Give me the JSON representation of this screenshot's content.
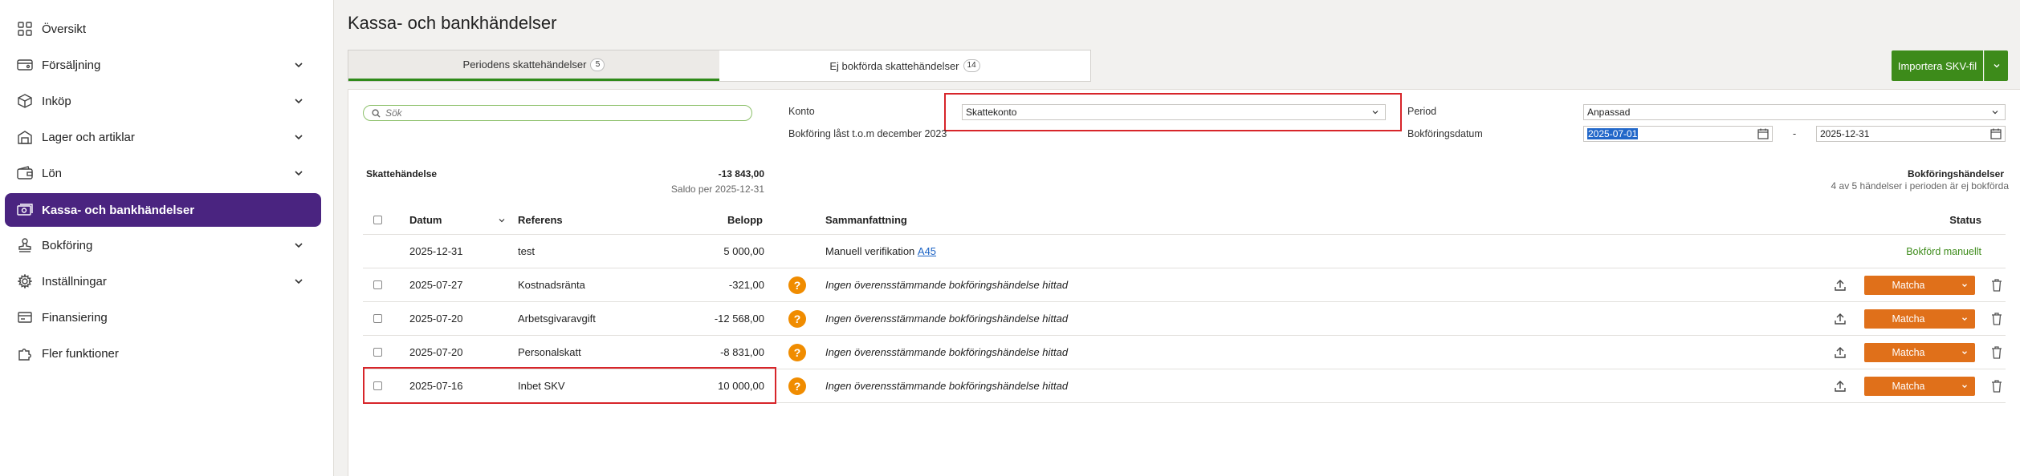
{
  "sidebar": {
    "items": [
      {
        "label": "Översikt",
        "icon": "grid-icon",
        "expandable": false
      },
      {
        "label": "Försäljning",
        "icon": "cart-icon",
        "expandable": true
      },
      {
        "label": "Inköp",
        "icon": "box-icon",
        "expandable": true
      },
      {
        "label": "Lager och artiklar",
        "icon": "warehouse-icon",
        "expandable": true
      },
      {
        "label": "Lön",
        "icon": "wallet-icon",
        "expandable": true
      },
      {
        "label": "Kassa- och bankhändelser",
        "icon": "bank-icon",
        "expandable": false,
        "active": true
      },
      {
        "label": "Bokföring",
        "icon": "stamp-icon",
        "expandable": true
      },
      {
        "label": "Inställningar",
        "icon": "gear-icon",
        "expandable": true
      },
      {
        "label": "Finansiering",
        "icon": "finance-icon",
        "expandable": false
      },
      {
        "label": "Fler funktioner",
        "icon": "puzzle-icon",
        "expandable": false
      }
    ]
  },
  "page": {
    "title": "Kassa- och bankhändelser"
  },
  "tabs": [
    {
      "label": "Periodens skattehändelser",
      "badge": "5",
      "active": true
    },
    {
      "label": "Ej bokförda skattehändelser",
      "badge": "14",
      "active": false
    }
  ],
  "import_button": {
    "label": "Importera SKV-fil"
  },
  "filters": {
    "search_placeholder": "Sök",
    "konto_label": "Konto",
    "konto_value": "Skattekonto",
    "lock_text": "Bokföring låst t.o.m december 2023",
    "period_label": "Period",
    "period_value": "Anpassad",
    "date_label": "Bokföringsdatum",
    "date_from": "2025-07-01",
    "date_sep": "-",
    "date_to": "2025-12-31"
  },
  "summary": {
    "left_label": "Skattehändelse",
    "amount": "-13 843,00",
    "saldo": "Saldo per 2025-12-31",
    "right_label": "Bokföringshändelser",
    "right_sub": "4 av 5 händelser i perioden är ej bokförda"
  },
  "table": {
    "headers": {
      "datum": "Datum",
      "referens": "Referens",
      "belopp": "Belopp",
      "sammanfattning": "Sammanfattning",
      "status": "Status"
    },
    "rows": [
      {
        "datum": "2025-12-31",
        "referens": "test",
        "belopp": "5 000,00",
        "sammanfattning": "Manuell verifikation",
        "link": "A45",
        "status": "Bokförd manuellt",
        "booked": true
      },
      {
        "datum": "2025-07-27",
        "referens": "Kostnadsränta",
        "belopp": "-321,00",
        "sammanfattning": "Ingen överensstämmande bokföringshändelse hittad",
        "match": "Matcha",
        "booked": false
      },
      {
        "datum": "2025-07-20",
        "referens": "Arbetsgivaravgift",
        "belopp": "-12 568,00",
        "sammanfattning": "Ingen överensstämmande bokföringshändelse hittad",
        "match": "Matcha",
        "booked": false
      },
      {
        "datum": "2025-07-20",
        "referens": "Personalskatt",
        "belopp": "-8 831,00",
        "sammanfattning": "Ingen överensstämmande bokföringshändelse hittad",
        "match": "Matcha",
        "booked": false
      },
      {
        "datum": "2025-07-16",
        "referens": "Inbet SKV",
        "belopp": "10 000,00",
        "sammanfattning": "Ingen överensstämmande bokföringshändelse hittad",
        "match": "Matcha",
        "booked": false
      }
    ]
  },
  "colors": {
    "brand_purple": "#4a2480",
    "green": "#3d8b1a",
    "orange": "#e0701a",
    "highlight_red": "#d7252a"
  }
}
